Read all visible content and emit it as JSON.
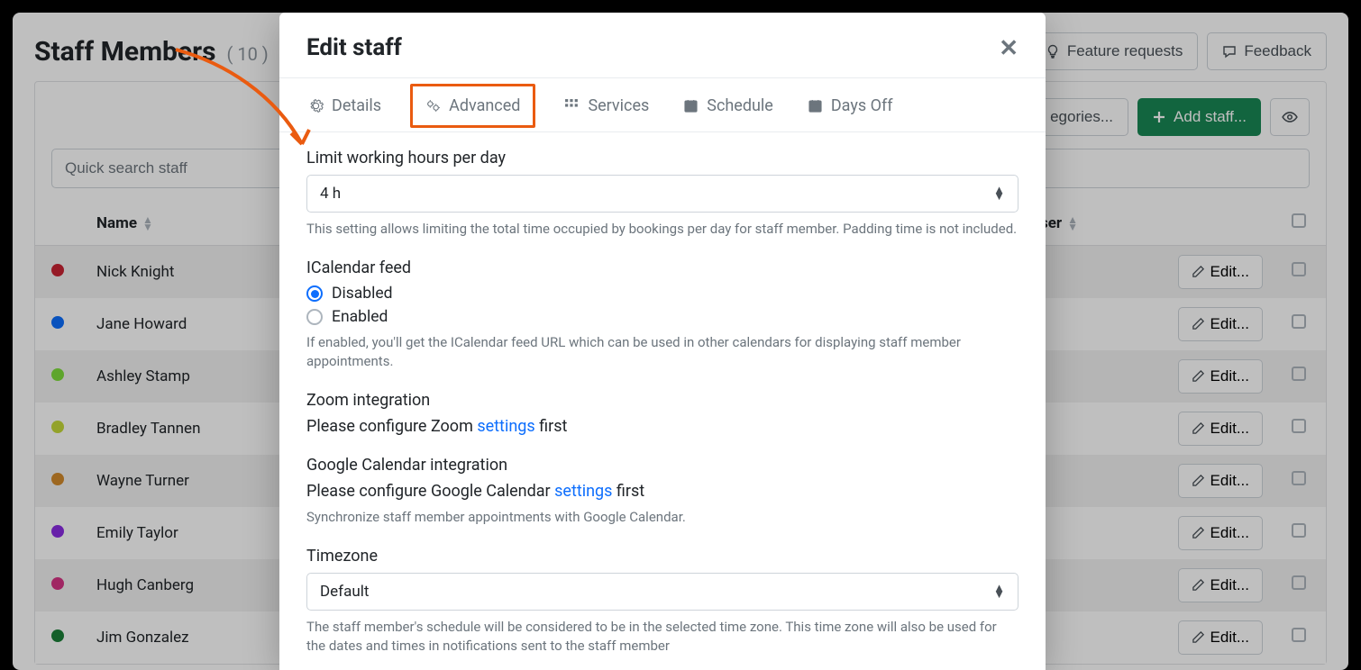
{
  "header": {
    "title": "Staff Members",
    "count": "( 10 )",
    "feature_requests": "Feature requests",
    "feedback": "Feedback"
  },
  "panel": {
    "categories_label": "egories...",
    "add_staff_label": "Add staff...",
    "search_placeholder": "Quick search staff"
  },
  "table": {
    "col_name": "Name",
    "col_user": "User",
    "edit_label": "Edit...",
    "rows": [
      {
        "name": "Nick Knight",
        "color": "#c82333"
      },
      {
        "name": "Jane Howard",
        "color": "#0d6efd"
      },
      {
        "name": "Ashley Stamp",
        "color": "#7edc3b"
      },
      {
        "name": "Bradley Tannen",
        "color": "#c5d938"
      },
      {
        "name": "Wayne Turner",
        "color": "#d28a2b"
      },
      {
        "name": "Emily Taylor",
        "color": "#8a2be2"
      },
      {
        "name": "Hugh Canberg",
        "color": "#d63384"
      },
      {
        "name": "Jim Gonzalez",
        "color": "#1a7f37"
      }
    ]
  },
  "modal": {
    "title": "Edit staff",
    "tabs": {
      "details": "Details",
      "advanced": "Advanced",
      "services": "Services",
      "schedule": "Schedule",
      "daysoff": "Days Off"
    },
    "limit_label": "Limit working hours per day",
    "limit_value": "4 h",
    "limit_help": "This setting allows limiting the total time occupied by bookings per day for staff member. Padding time is not included.",
    "ical_label": "ICalendar feed",
    "ical_disabled": "Disabled",
    "ical_enabled": "Enabled",
    "ical_help": "If enabled, you'll get the ICalendar feed URL which can be used in other calendars for displaying staff member appointments.",
    "zoom_label": "Zoom integration",
    "zoom_text_pre": "Please configure Zoom ",
    "zoom_link": "settings",
    "zoom_text_post": " first",
    "gcal_label": "Google Calendar integration",
    "gcal_text_pre": "Please configure Google Calendar ",
    "gcal_link": "settings",
    "gcal_text_post": " first",
    "gcal_help": "Synchronize staff member appointments with Google Calendar.",
    "tz_label": "Timezone",
    "tz_value": "Default",
    "tz_help": "The staff member's schedule will be considered to be in the selected time zone. This time zone will also be used for the dates and times in notifications sent to the staff member"
  }
}
